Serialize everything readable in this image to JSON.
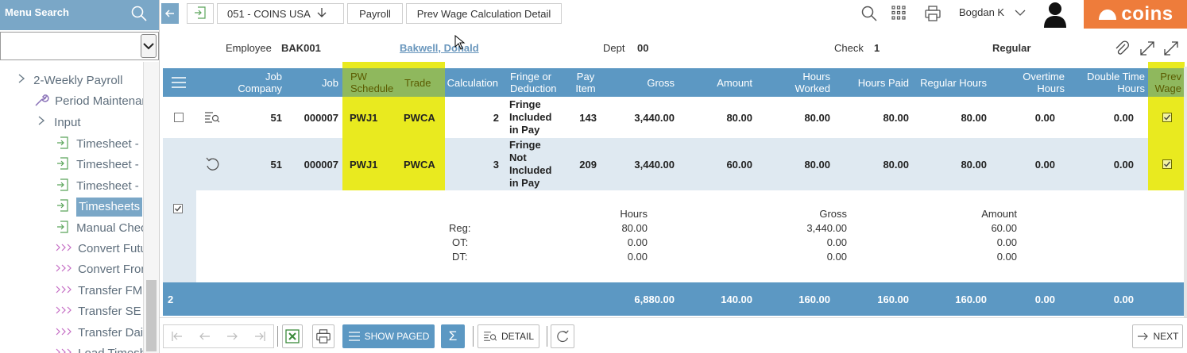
{
  "sidebar": {
    "search_label": "Menu Search",
    "items": [
      {
        "label": "2-Weekly Payroll",
        "icon": "chevron-right-icon"
      },
      {
        "label": "Period Maintenan",
        "icon": "wrench-icon"
      },
      {
        "label": "Input",
        "icon": "chevron-right-icon"
      },
      {
        "label": "Timesheet - b",
        "icon": "enter-arrow-icon"
      },
      {
        "label": "Timesheet - b",
        "icon": "enter-arrow-icon"
      },
      {
        "label": "Timesheet - b",
        "icon": "enter-arrow-icon"
      },
      {
        "label": "Timesheets",
        "icon": "enter-arrow-icon",
        "selected": true
      },
      {
        "label": "Manual Checl",
        "icon": "enter-arrow-icon"
      },
      {
        "label": "Convert Futu",
        "icon": "triple-chevron-icon"
      },
      {
        "label": "Convert From",
        "icon": "triple-chevron-icon"
      },
      {
        "label": "Transfer FM V",
        "icon": "triple-chevron-icon"
      },
      {
        "label": "Transfer SE V",
        "icon": "triple-chevron-icon"
      },
      {
        "label": "Transfer Daily",
        "icon": "triple-chevron-icon"
      },
      {
        "label": "Load Timesh",
        "icon": "triple-chevron-icon"
      }
    ]
  },
  "topbar": {
    "crumbs": [
      "051 - COINS USA",
      "Payroll",
      "Prev Wage Calculation Detail"
    ],
    "user": "Bogdan K",
    "logo": "coins"
  },
  "info": {
    "employee_label": "Employee",
    "employee_code": "BAK001",
    "employee_name": "Bakwell, Donald",
    "dept_label": "Dept",
    "dept_value": "00",
    "check_label": "Check",
    "check_value": "1",
    "check_type": "Regular"
  },
  "grid": {
    "headers": {
      "job_company": "Job Company",
      "job": "Job",
      "pw_schedule": "PW Schedule",
      "trade": "Trade",
      "calculation": "Calculation",
      "fringe": "Fringe or Deduction",
      "pay_item": "Pay Item",
      "gross": "Gross",
      "amount": "Amount",
      "hours_worked": "Hours Worked",
      "hours_paid": "Hours Paid",
      "regular_hours": "Regular Hours",
      "overtime_hours": "Overtime Hours",
      "double_time_hours": "Double Time Hours",
      "prev_wage": "Prev Wage"
    },
    "rows": [
      {
        "job_company": "51",
        "job": "000007",
        "pw_schedule": "PWJ1",
        "trade": "PWCA",
        "calculation": "2",
        "fringe": "Fringe Included in Pay",
        "pay_item": "143",
        "gross": "3,440.00",
        "amount": "80.00",
        "hours_worked": "80.00",
        "hours_paid": "80.00",
        "regular_hours": "80.00",
        "overtime_hours": "0.00",
        "double_time_hours": "0.00",
        "prev_wage": true
      },
      {
        "job_company": "51",
        "job": "000007",
        "pw_schedule": "PWJ1",
        "trade": "PWCA",
        "calculation": "3",
        "fringe": "Fringe Not Included in Pay",
        "pay_item": "209",
        "gross": "3,440.00",
        "amount": "60.00",
        "hours_worked": "80.00",
        "hours_paid": "80.00",
        "regular_hours": "80.00",
        "overtime_hours": "0.00",
        "double_time_hours": "0.00",
        "prev_wage": true
      }
    ],
    "detail": {
      "col_hours": "Hours",
      "col_gross": "Gross",
      "col_amount": "Amount",
      "lines": [
        {
          "label": "Reg:",
          "hours": "80.00",
          "gross": "3,440.00",
          "amount": "60.00"
        },
        {
          "label": "OT:",
          "hours": "0.00",
          "gross": "0.00",
          "amount": "0.00"
        },
        {
          "label": "DT:",
          "hours": "0.00",
          "gross": "0.00",
          "amount": "0.00"
        }
      ]
    },
    "footer": {
      "count": "2",
      "gross": "6,880.00",
      "amount": "140.00",
      "hours_worked": "160.00",
      "hours_paid": "160.00",
      "regular_hours": "160.00",
      "overtime_hours": "0.00",
      "double_time_hours": "0.00"
    }
  },
  "toolbar": {
    "show_paged": "SHOW PAGED",
    "sigma": "Σ",
    "detail": "DETAIL",
    "next": "NEXT"
  },
  "colors": {
    "header_blue": "#5c98c3",
    "sidebar_blue": "#7aa7c7",
    "highlight": "#e9ea1f",
    "row_alt": "#dfe9f1",
    "logo_orange": "#ee7c3b"
  }
}
